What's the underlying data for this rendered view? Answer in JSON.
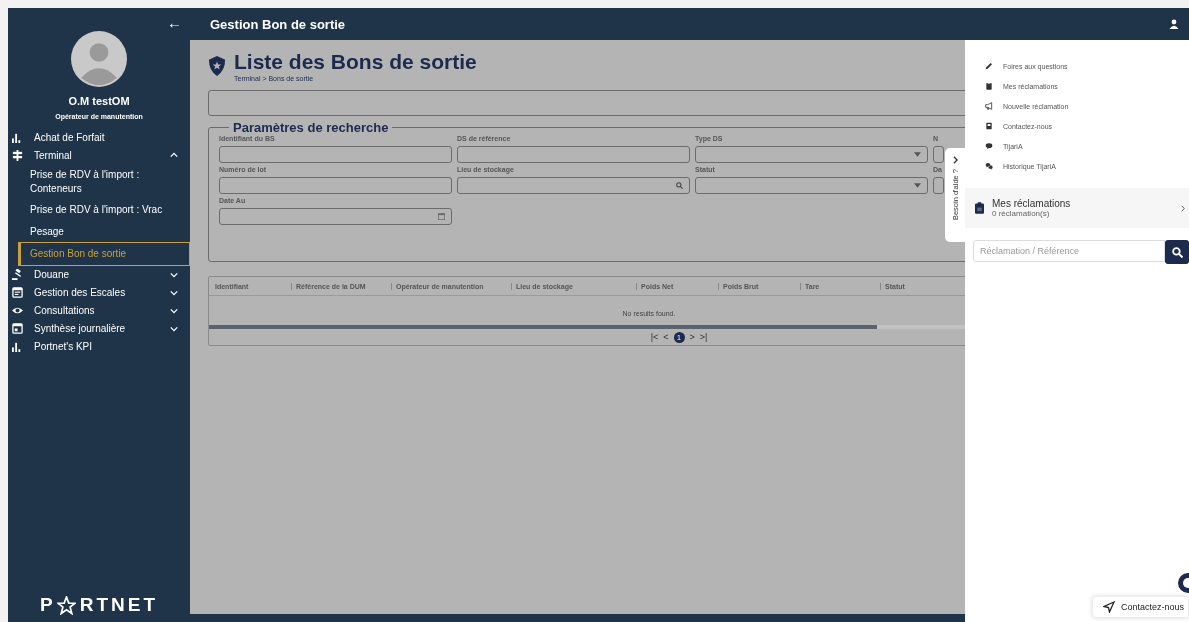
{
  "sidebar": {
    "back": "←",
    "user": {
      "name": "O.M testOM",
      "role": "Opérateur de manutention"
    },
    "menu": [
      {
        "label": "Achat de Forfait"
      },
      {
        "label": "Terminal",
        "expanded": true,
        "children": [
          {
            "label": "Prise de RDV à l'import : Conteneurs",
            "selected": false
          },
          {
            "label": "Prise de RDV à l'import : Vrac",
            "selected": false
          },
          {
            "label": "Pesage",
            "selected": false
          },
          {
            "label": "Gestion Bon de sortie",
            "selected": true
          }
        ]
      },
      {
        "label": "Douane",
        "expanded": false
      },
      {
        "label": "Gestion des Escales",
        "expanded": false
      },
      {
        "label": "Consultations",
        "expanded": false
      },
      {
        "label": "Synthèse journalière",
        "expanded": false
      },
      {
        "label": "Portnet's KPI"
      }
    ],
    "logo": {
      "before": "P",
      "after": "RTNET"
    }
  },
  "header": {
    "title": "Gestion Bon de sortie"
  },
  "page": {
    "title": "Liste des Bons de sortie",
    "breadcrumb": "Terminal > Bons de sortie"
  },
  "search": {
    "legend": "Paramètres de recherche",
    "fields": [
      {
        "label": "Identifiant du BS",
        "kind": "text"
      },
      {
        "label": "DS de référence",
        "kind": "text"
      },
      {
        "label": "Type DS",
        "kind": "select"
      },
      {
        "label": "N",
        "kind": "text"
      },
      {
        "label": "Numéro de lot",
        "kind": "text"
      },
      {
        "label": "Lieu de stockage",
        "kind": "search"
      },
      {
        "label": "Statut",
        "kind": "select"
      },
      {
        "label": "Da",
        "kind": "text"
      },
      {
        "label": "Date Au",
        "kind": "date"
      }
    ]
  },
  "table": {
    "columns": [
      "Identifiant",
      "Référence de la DUM",
      "Opérateur de manutention",
      "Lieu de stockage",
      "Poids Net",
      "Poids Brut",
      "Tare",
      "Statut"
    ],
    "empty": "No results found.",
    "pagination": {
      "first": "|<",
      "prev": "<",
      "pages": [
        {
          "label": "1",
          "selected": true
        }
      ],
      "next": ">",
      "last": ">|"
    }
  },
  "help_tab": {
    "label": "Besoin d'aide ?"
  },
  "help_panel": {
    "links": [
      {
        "label": "Foires aux questions"
      },
      {
        "label": "Mes réclamations"
      },
      {
        "label": "Nouvelle réclamation"
      },
      {
        "label": "Contactez-nous"
      },
      {
        "label": "TijariA"
      },
      {
        "label": "Historique TijariA"
      }
    ],
    "claims": {
      "title": "Mes réclamations",
      "count": "0 réclamation(s)"
    },
    "search": {
      "placeholder": "Réclamation / Référence"
    },
    "contact": "Contactez-nous"
  }
}
